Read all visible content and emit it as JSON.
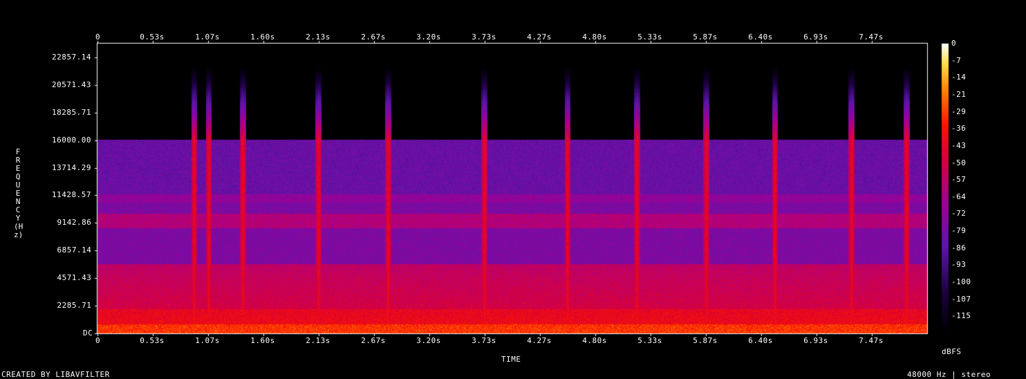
{
  "chart_data": {
    "type": "heatmap",
    "xlabel": "TIME",
    "ylabel": "FREQUENCY (Hz)",
    "x_ticks": [
      "0",
      "0.53s",
      "1.07s",
      "1.60s",
      "2.13s",
      "2.67s",
      "3.20s",
      "3.73s",
      "4.27s",
      "4.80s",
      "5.33s",
      "5.87s",
      "6.40s",
      "6.93s",
      "7.47s"
    ],
    "y_ticks": [
      "22857.14",
      "20571.43",
      "18285.71",
      "16000.00",
      "13714.29",
      "11428.57",
      "9142.86",
      "6857.14",
      "4571.43",
      "2285.71",
      "DC"
    ],
    "colorbar_ticks": [
      "0",
      "-7",
      "-14",
      "-21",
      "-29",
      "-36",
      "-43",
      "-50",
      "-57",
      "-64",
      "-72",
      "-79",
      "-86",
      "-93",
      "-100",
      "-107",
      "-115"
    ],
    "colorbar_unit": "dBFS",
    "x_range_s": [
      0,
      8.0
    ],
    "y_range_hz": [
      0,
      24000
    ],
    "db_range": [
      -120,
      0
    ],
    "content_cutoff_hz": 16000,
    "transients_s": [
      0.93,
      1.07,
      1.4,
      2.13,
      2.8,
      3.73,
      4.53,
      5.2,
      5.87,
      6.53,
      7.27,
      7.8
    ],
    "footer_left": "CREATED BY LIBAVFILTER",
    "footer_right": "48000 Hz | stereo",
    "grid": false
  }
}
